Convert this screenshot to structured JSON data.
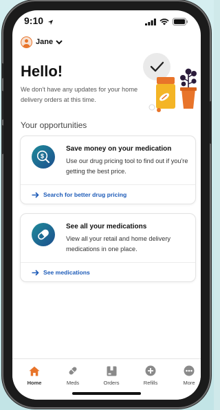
{
  "status": {
    "time": "9:10"
  },
  "profile": {
    "name": "Jane"
  },
  "greeting": {
    "title": "Hello!",
    "message": "We don't have any updates for your home delivery orders at this time."
  },
  "opportunities": {
    "title": "Your opportunities",
    "cards": [
      {
        "title": "Save money on your medication",
        "description": "Use our drug pricing tool to find out if you're getting the best price.",
        "link": "Search for better drug pricing",
        "icon": "dollar-search-icon"
      },
      {
        "title": "See all your medications",
        "description": "View all your retail and home delivery medications in one place.",
        "link": "See medications",
        "icon": "pill-icon"
      }
    ]
  },
  "tabs": [
    {
      "label": "Home",
      "icon": "home-icon",
      "active": true
    },
    {
      "label": "Meds",
      "icon": "pill-icon",
      "active": false
    },
    {
      "label": "Orders",
      "icon": "box-icon",
      "active": false
    },
    {
      "label": "Refills",
      "icon": "plus-circle-icon",
      "active": false
    },
    {
      "label": "More",
      "icon": "more-icon",
      "active": false
    }
  ],
  "colors": {
    "accent_orange": "#e8742a",
    "link_blue": "#1d5bb8",
    "icon_teal": "#1e8a99",
    "icon_navy": "#1d4f8e"
  }
}
